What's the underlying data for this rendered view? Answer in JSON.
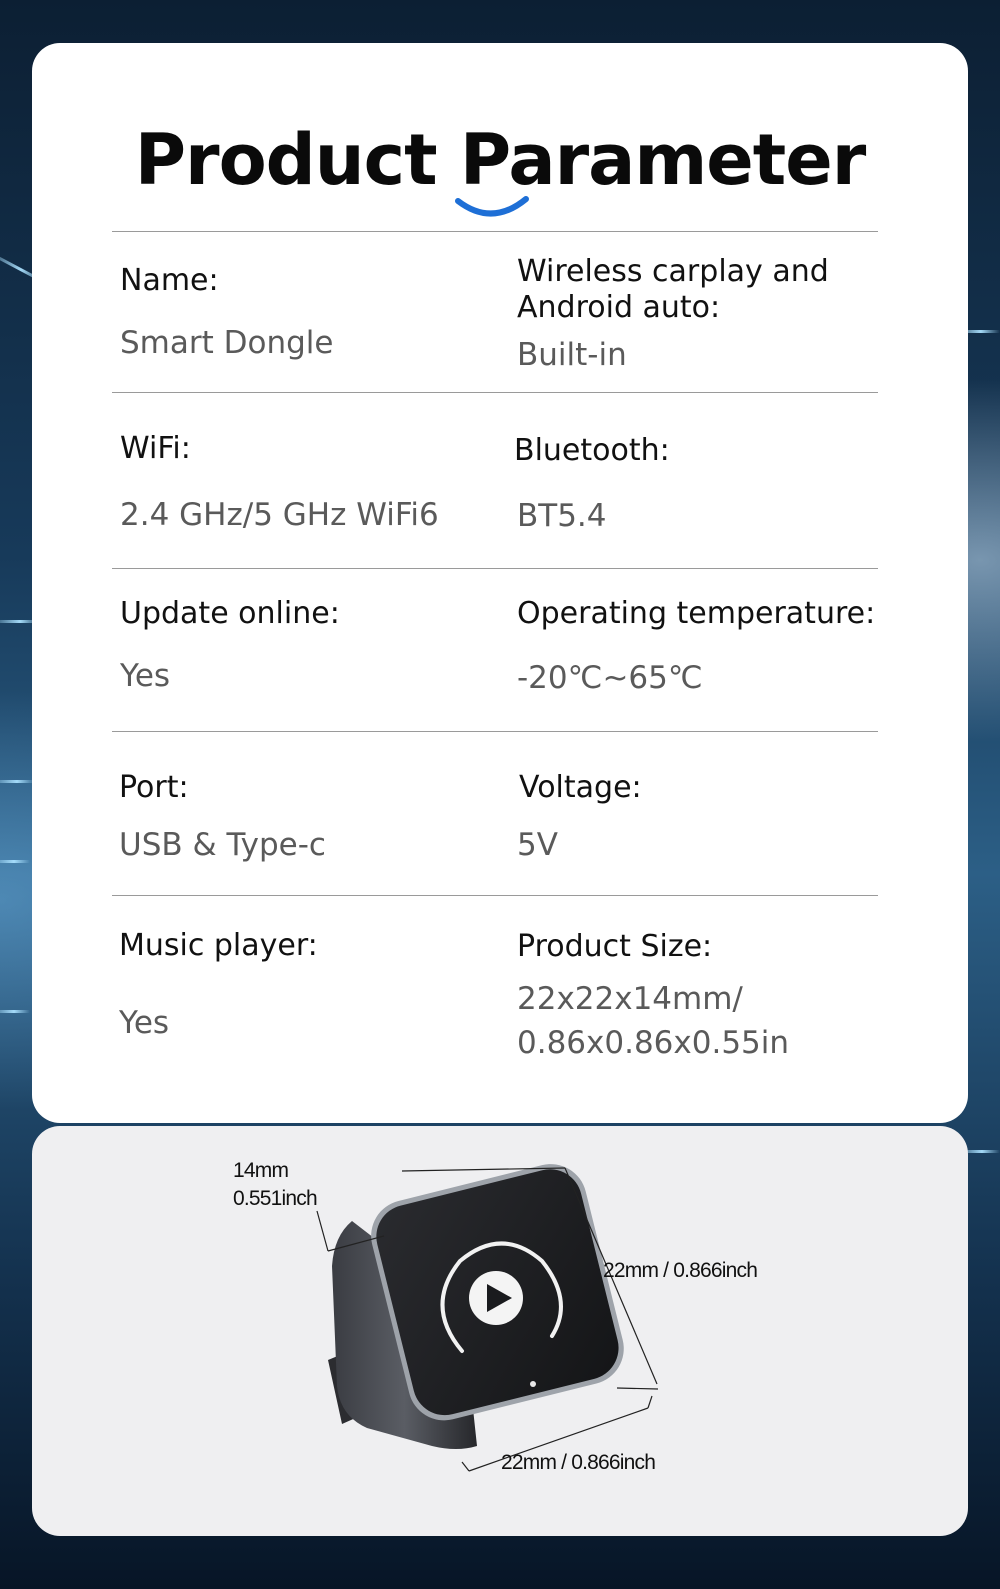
{
  "page": {
    "title": "Product Parameter"
  },
  "specs": {
    "name": {
      "label": "Name:",
      "value": "Smart Dongle"
    },
    "wireless": {
      "label_line1": "Wireless carplay and",
      "label_line2": "Android auto:",
      "value": "Built-in"
    },
    "wifi": {
      "label": "WiFi:",
      "value": "2.4 GHz/5 GHz WiFi6"
    },
    "bluetooth": {
      "label": "Bluetooth:",
      "value": "BT5.4"
    },
    "update": {
      "label": "Update online:",
      "value": "Yes"
    },
    "temperature": {
      "label": "Operating temperature:",
      "value": "-20℃~65℃"
    },
    "port": {
      "label": "Port:",
      "value": "USB & Type-c"
    },
    "voltage": {
      "label": "Voltage:",
      "value": "5V"
    },
    "music": {
      "label": "Music player:",
      "value": "Yes"
    },
    "size": {
      "label": "Product Size:",
      "value_line1": "22x22x14mm/",
      "value_line2": "0.86x0.86x0.55in"
    }
  },
  "dimensions": {
    "depth_mm": "14mm",
    "depth_inch": "0.551inch",
    "height": "22mm / 0.866inch",
    "width": "22mm / 0.866inch"
  },
  "icons": {
    "title_underline": "smile-curve-icon",
    "device_button": "play-button-icon"
  },
  "colors": {
    "accent": "#1e6fd6",
    "card": "#ffffff",
    "device": "#1c1d20"
  }
}
